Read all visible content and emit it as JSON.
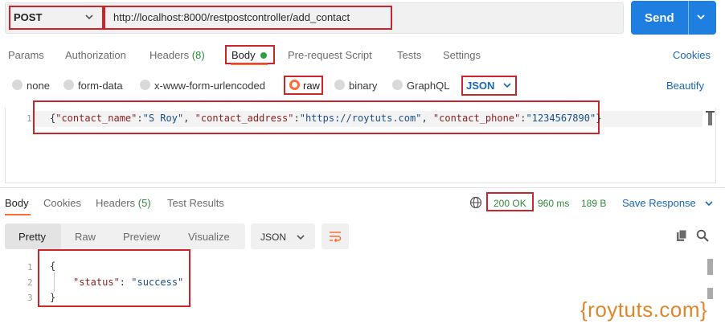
{
  "request": {
    "method": "POST",
    "url": "http://localhost:8000/restpostcontroller/add_contact",
    "send_label": "Send",
    "tabs": [
      {
        "label": "Params"
      },
      {
        "label": "Authorization"
      },
      {
        "label": "Headers",
        "count": "(8)"
      },
      {
        "label": "Body"
      },
      {
        "label": "Pre-request Script"
      },
      {
        "label": "Tests"
      },
      {
        "label": "Settings"
      }
    ],
    "cookies_label": "Cookies",
    "body_types": [
      "none",
      "form-data",
      "x-www-form-urlencoded",
      "raw",
      "binary",
      "GraphQL"
    ],
    "selected_body_type": "raw",
    "format": "JSON",
    "beautify_label": "Beautify",
    "body_line_number": "1",
    "body": {
      "k1": "\"contact_name\"",
      "v1": "\"S Roy\"",
      "k2": "\"contact_address\"",
      "v2": "\"https://roytuts.com\"",
      "k3": "\"contact_phone\"",
      "v3": "\"1234567890\""
    }
  },
  "response": {
    "tabs": [
      {
        "label": "Body"
      },
      {
        "label": "Cookies"
      },
      {
        "label": "Headers",
        "count": "(5)"
      },
      {
        "label": "Test Results"
      }
    ],
    "status": "200 OK",
    "time": "960 ms",
    "size": "189 B",
    "save_label": "Save Response",
    "views": [
      "Pretty",
      "Raw",
      "Preview",
      "Visualize"
    ],
    "language": "JSON",
    "line_numbers": [
      "1",
      "2",
      "3"
    ],
    "body": {
      "open": "{",
      "key": "\"status\"",
      "value": "\"success\"",
      "close": "}"
    }
  },
  "watermark": "{roytuts.com}",
  "colors": {
    "accent": "#ff6c37",
    "send": "#1e7fe1",
    "link": "#1a66b8",
    "success": "#2e8b3a",
    "annotation": "#c9252c"
  }
}
